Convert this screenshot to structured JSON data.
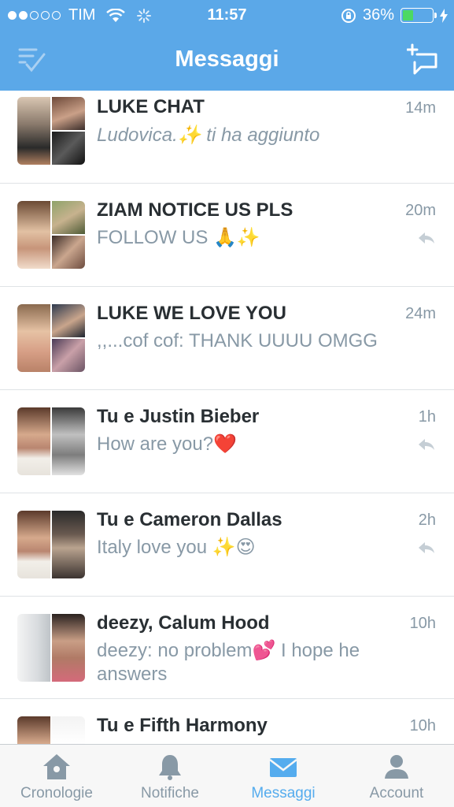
{
  "status_bar": {
    "carrier": "TIM",
    "time": "11:57",
    "battery_percent": "36%",
    "battery_level": 0.36,
    "signal_bars_filled": 2,
    "signal_bars_total": 5
  },
  "nav": {
    "title": "Messaggi",
    "left_icon": "edit-list-icon",
    "right_icon": "new-message-icon"
  },
  "conversations": [
    {
      "title": "LUKE CHAT",
      "time": "14m",
      "preview": "Ludovica.✨ ti ha aggiunto",
      "preview_italic": true,
      "replied": false
    },
    {
      "title": "ZIAM NOTICE US PLS",
      "time": "20m",
      "preview": "FOLLOW US 🙏✨",
      "preview_italic": false,
      "replied": true
    },
    {
      "title": "LUKE WE LOVE YOU",
      "time": "24m",
      "preview": ",,...cof cof: THANK UUUU OMGG",
      "preview_italic": false,
      "replied": false
    },
    {
      "title": "Tu e Justin Bieber",
      "time": "1h",
      "preview": "How are you?❤️",
      "preview_italic": false,
      "replied": true
    },
    {
      "title": "Tu e Cameron Dallas",
      "time": "2h",
      "preview": "Italy love you ✨😍",
      "preview_italic": false,
      "replied": true
    },
    {
      "title": "deezy, Calum Hood",
      "time": "10h",
      "preview": "deezy: no problem💕 I hope he answers",
      "preview_italic": false,
      "replied": false
    },
    {
      "title": "Tu e Fifth Harmony",
      "time": "10h",
      "preview": "",
      "preview_italic": false,
      "replied": false
    }
  ],
  "tabs": [
    {
      "label": "Cronologie",
      "icon": "home-icon",
      "active": false
    },
    {
      "label": "Notifiche",
      "icon": "bell-icon",
      "active": false
    },
    {
      "label": "Messaggi",
      "icon": "envelope-icon",
      "active": true
    },
    {
      "label": "Account",
      "icon": "person-icon",
      "active": false
    }
  ],
  "colors": {
    "header": "#5ba8e8",
    "accent": "#55acee",
    "muted": "#8899a6",
    "title_text": "#292f33",
    "battery": "#4cd964"
  }
}
